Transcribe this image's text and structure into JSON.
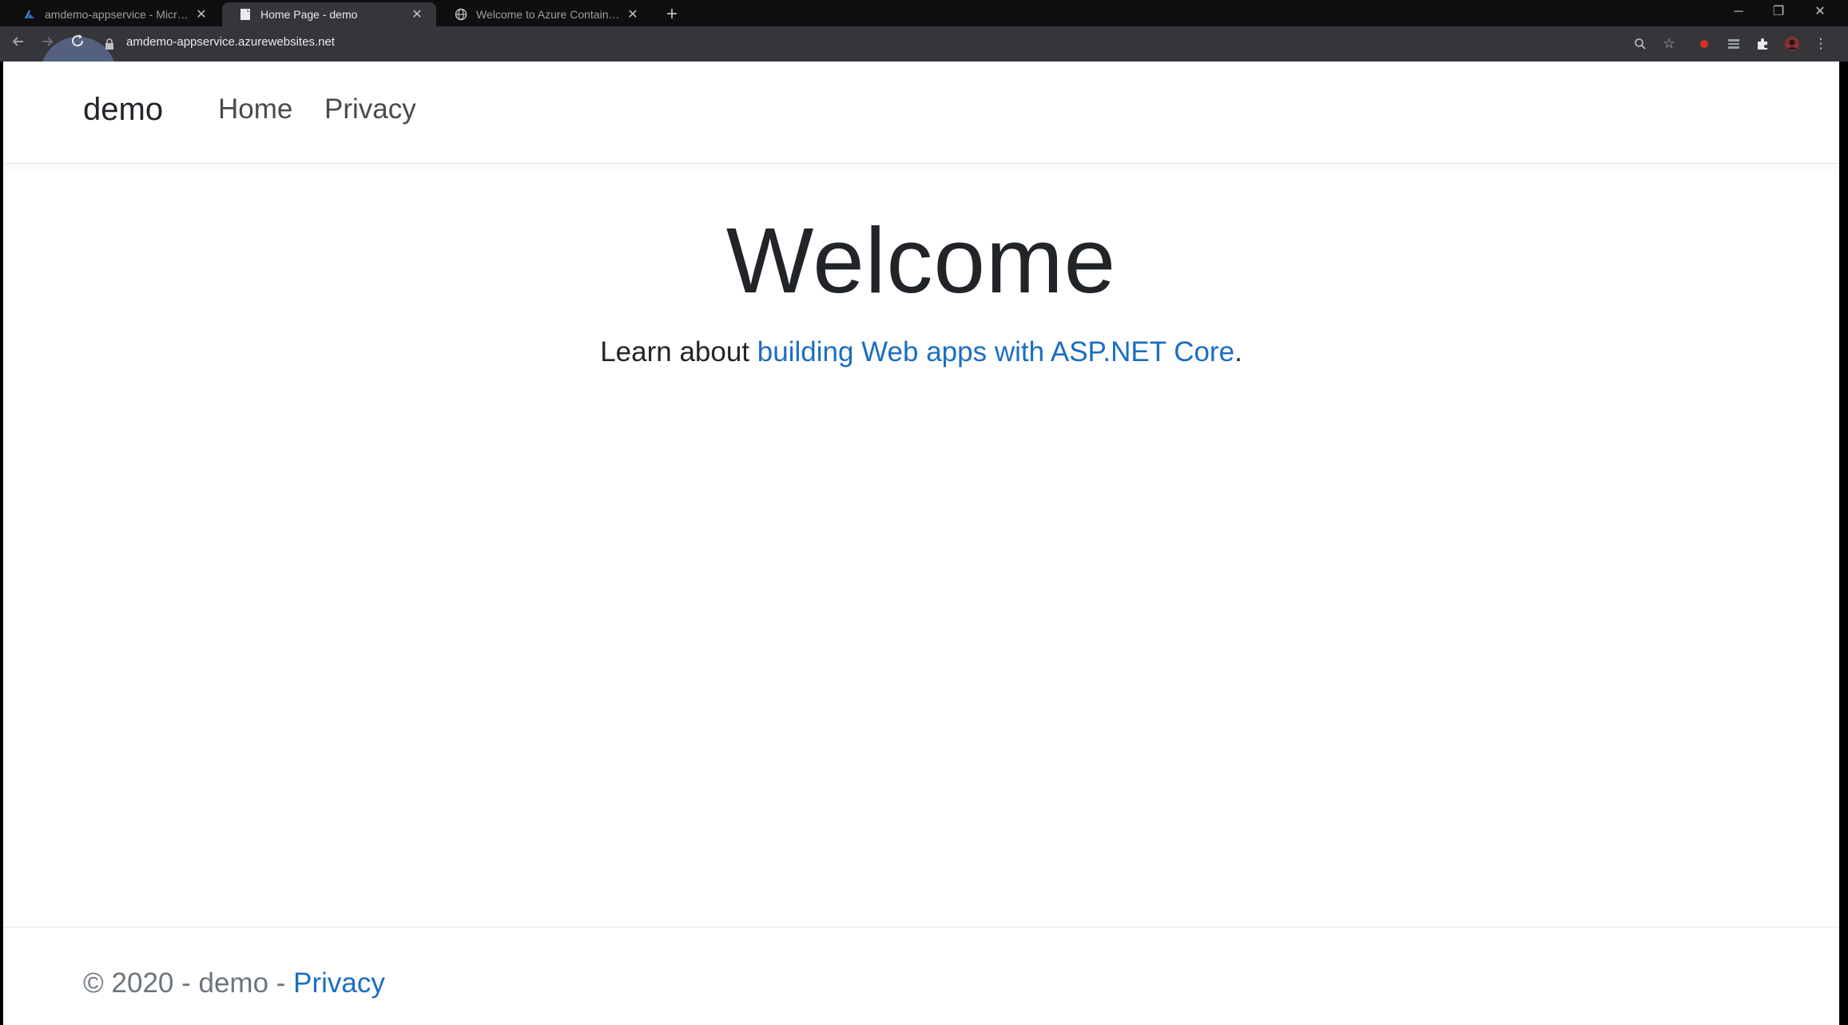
{
  "browser": {
    "tabs": [
      {
        "title": "amdemo-appservice - Microsoft",
        "favicon": "azure-icon",
        "active": false
      },
      {
        "title": "Home Page - demo",
        "favicon": "page-icon",
        "active": true
      },
      {
        "title": "Welcome to Azure Container Ins",
        "favicon": "globe-icon",
        "active": false
      }
    ],
    "new_tab_symbol": "+",
    "close_symbol": "✕",
    "address": "amdemo-appservice.azurewebsites.net"
  },
  "site": {
    "brand": "demo",
    "nav": {
      "home": "Home",
      "privacy": "Privacy"
    },
    "heading": "Welcome",
    "learn_prefix": "Learn about ",
    "learn_link": "building Web apps with ASP.NET Core",
    "learn_suffix": ".",
    "footer_prefix": "© 2020 - demo - ",
    "footer_link": "Privacy"
  },
  "colors": {
    "link": "#1b6ec2",
    "text": "#212529",
    "chrome_dark": "#202124"
  }
}
